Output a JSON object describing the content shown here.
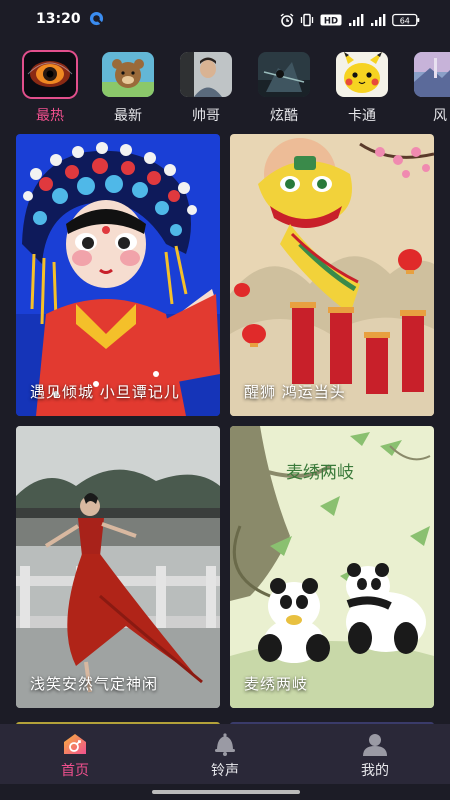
{
  "status": {
    "time": "13:20",
    "battery": "64",
    "hd_label": "HD"
  },
  "categories": [
    {
      "label": "最热",
      "active": true,
      "thumb": "galaxy-eye"
    },
    {
      "label": "最新",
      "active": false,
      "thumb": "cartoon-bear"
    },
    {
      "label": "帅哥",
      "active": false,
      "thumb": "man-portrait"
    },
    {
      "label": "炫酷",
      "active": false,
      "thumb": "soldier-scene"
    },
    {
      "label": "卡通",
      "active": false,
      "thumb": "pikachu"
    },
    {
      "label": "风",
      "active": false,
      "thumb": "landscape"
    }
  ],
  "cards": [
    {
      "title": "遇见倾城 小旦谭记儿",
      "image": "opera-girl"
    },
    {
      "title": "醒狮 鸿运当头",
      "image": "lion-dance"
    },
    {
      "title": "浅笑安然气定神闲",
      "image": "dancer-woman"
    },
    {
      "title": "麦绣两岐",
      "image": "panda-painting",
      "painting_text": "麦绣两岐"
    }
  ],
  "tabs": [
    {
      "label": "首页",
      "active": true,
      "icon": "home-icon"
    },
    {
      "label": "铃声",
      "active": false,
      "icon": "bell-icon"
    },
    {
      "label": "我的",
      "active": false,
      "icon": "profile-icon"
    }
  ],
  "colors": {
    "background": "#1c1c26",
    "tabbar": "#2a2838",
    "accent": "#f0508e"
  }
}
